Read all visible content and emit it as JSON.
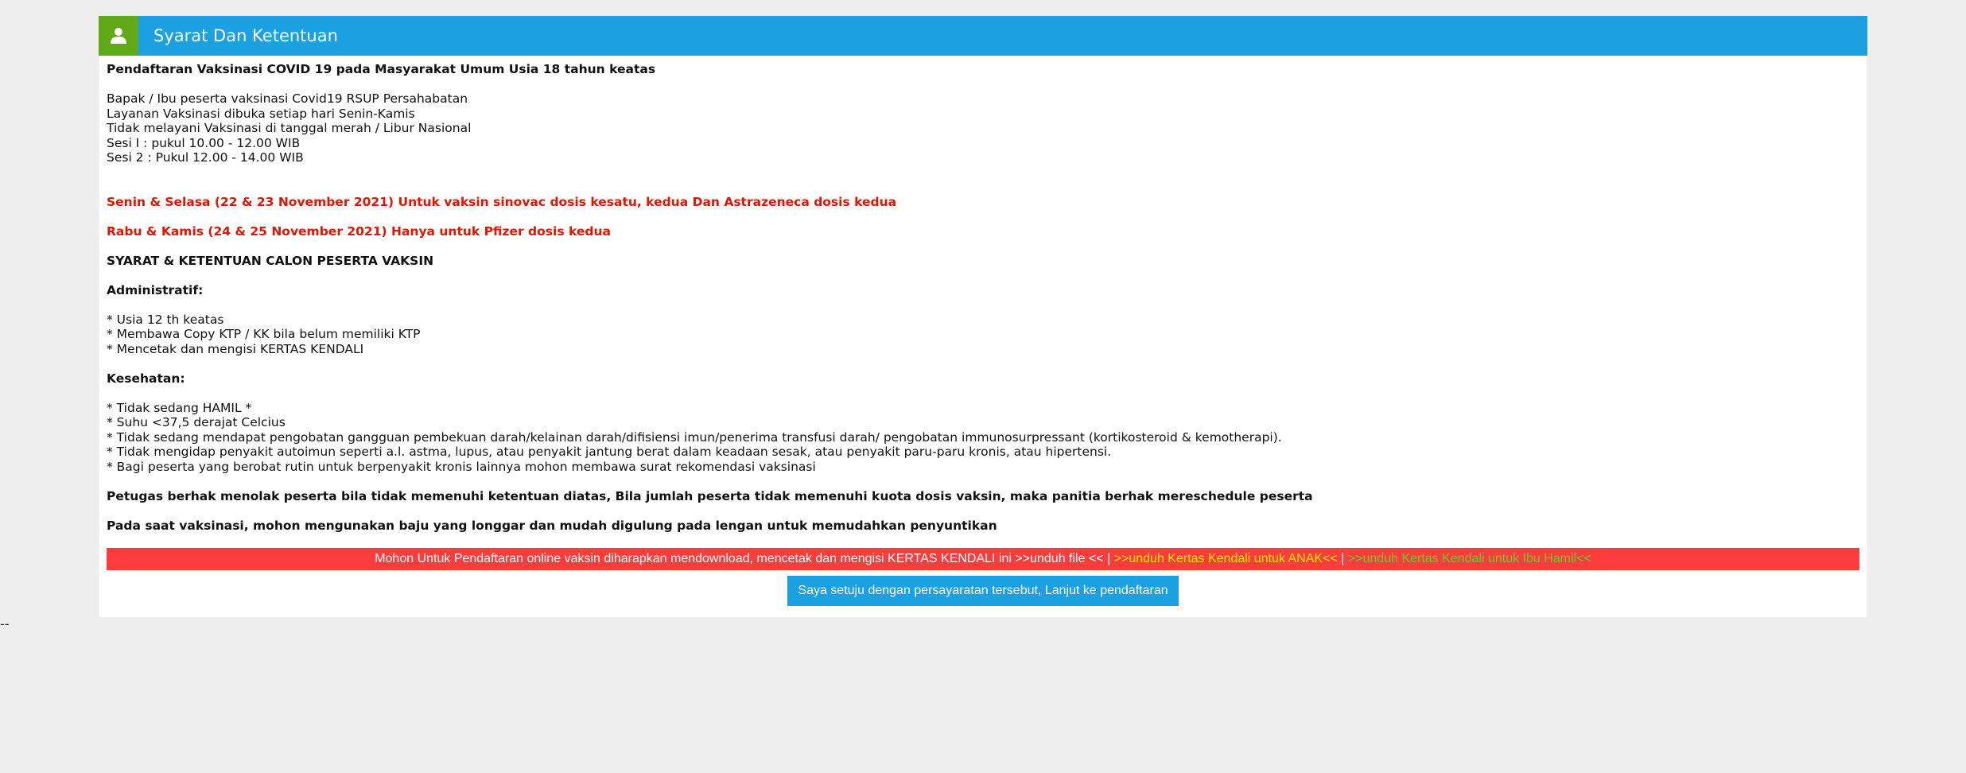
{
  "panel": {
    "title": "Syarat Dan Ketentuan",
    "icon": "user-icon",
    "colors": {
      "header": "#1ba1e2",
      "icon_box": "#60a917",
      "notice_bar": "#fd3d3d",
      "red_text": "#e51400",
      "button": "#1ba1e2"
    }
  },
  "content": {
    "heading": "Pendaftaran Vaksinasi COVID 19 pada Masyarakat Umum Usia 18 tahun keatas",
    "intro_lines": [
      "Bapak / Ibu peserta vaksinasi Covid19 RSUP Persahabatan",
      "Layanan Vaksinasi dibuka setiap hari Senin-Kamis",
      "Tidak melayani Vaksinasi di tanggal merah / Libur Nasional",
      "Sesi I : pukul 10.00 - 12.00 WIB",
      "Sesi 2 : Pukul 12.00 - 14.00 WIB"
    ],
    "schedule_1": "Senin & Selasa (22 & 23 November 2021) Untuk vaksin sinovac dosis kesatu, kedua Dan Astrazeneca dosis kedua",
    "schedule_2": "Rabu & Kamis (24 & 25 November 2021) Hanya untuk Pfizer dosis kedua",
    "terms_heading": "SYARAT & KETENTUAN CALON PESERTA VAKSIN",
    "admin_heading": "Administratif:",
    "admin_items": [
      "* Usia 12 th keatas",
      "* Membawa Copy KTP / KK bila belum memiliki KTP",
      "* Mencetak dan mengisi KERTAS KENDALI"
    ],
    "health_heading": "Kesehatan:",
    "health_items": [
      "* Tidak sedang HAMIL *",
      "* Suhu <37,5 derajat Celcius",
      "* Tidak sedang mendapat pengobatan gangguan pembekuan darah/kelainan darah/difisiensi imun/penerima transfusi darah/ pengobatan immunosurpressant (kortikosteroid & kemotherapi).",
      "* Tidak mengidap penyakit autoimun seperti a.l. astma, lupus, atau penyakit jantung berat dalam keadaan sesak, atau penyakit paru-paru kronis, atau hipertensi.",
      "* Bagi peserta yang berobat rutin untuk berpenyakit kronis lainnya mohon membawa surat rekomendasi vaksinasi"
    ],
    "note_1": "Petugas berhak menolak peserta bila tidak memenuhi ketentuan diatas, Bila jumlah peserta tidak memenuhi kuota dosis vaksin, maka panitia berhak mereschedule peserta",
    "note_2": "Pada saat vaksinasi, mohon mengunakan baju yang longgar dan mudah digulung pada lengan untuk memudahkan penyuntikan"
  },
  "notice": {
    "text": "Mohon Untuk Pendaftaran online vaksin diharapkan mendownload, mencetak dan mengisi KERTAS KENDALI ini ",
    "link_file": ">>unduh file <<",
    "separator": " | ",
    "link_anak": ">>unduh Kertas Kendali untuk ANAK<<",
    "link_hamil": ">>unduh Kertas Kendali untuk Ibu Hamil<<"
  },
  "agree_button_label": "Saya setuju dengan persayaratan tersebut, Lanjut ke pendaftaran",
  "footer_text": "--"
}
